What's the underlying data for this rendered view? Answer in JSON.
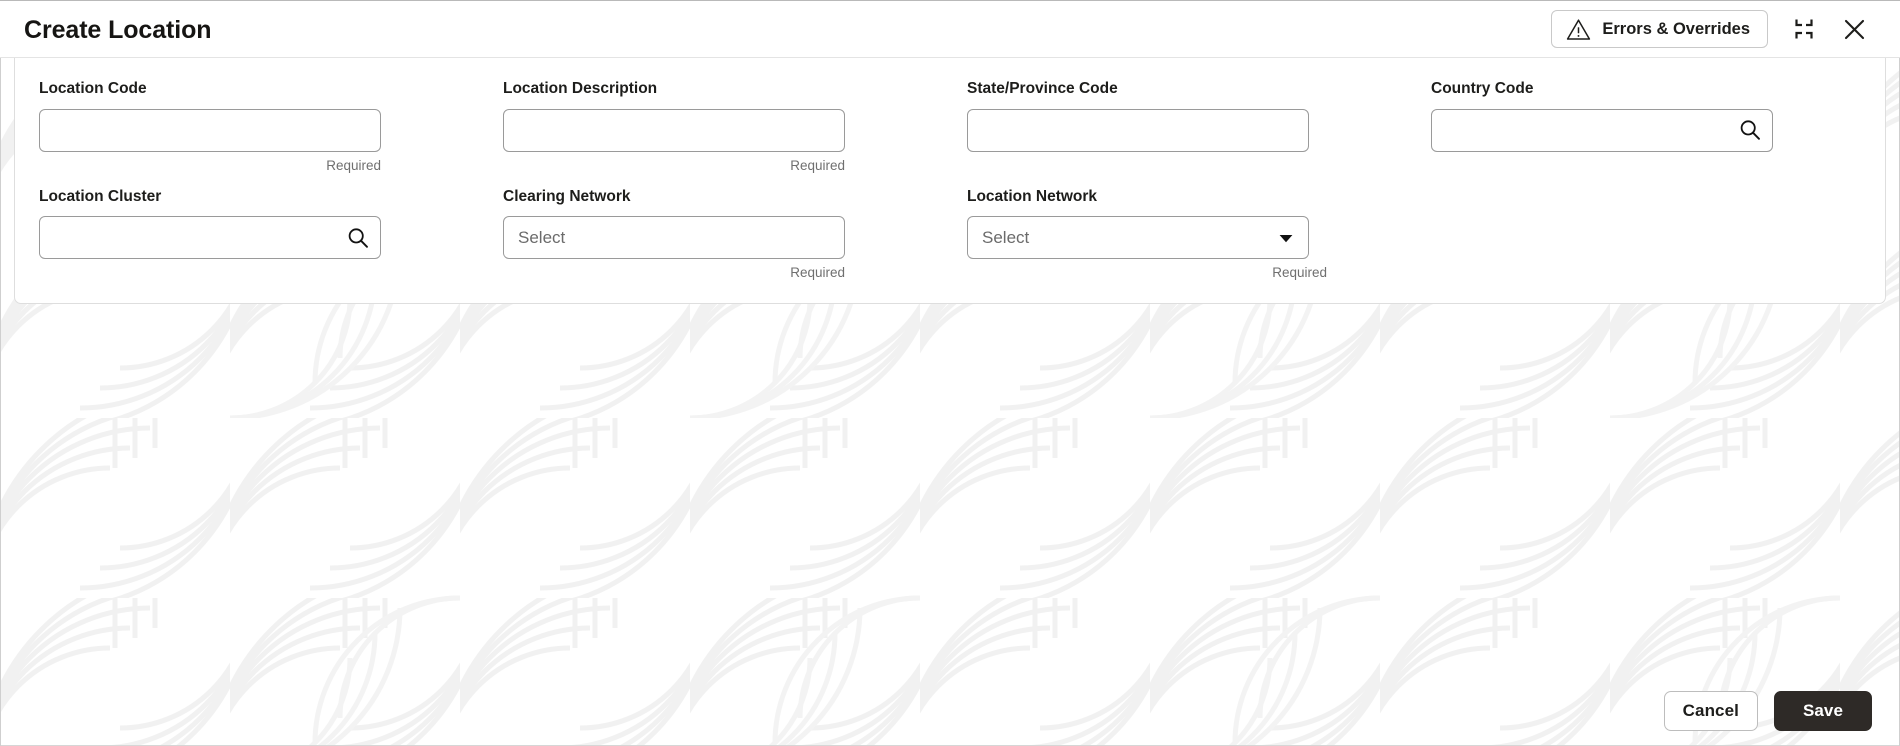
{
  "header": {
    "title": "Create Location",
    "errors_button_label": "Errors & Overrides",
    "warning_icon": "warning-triangle-icon",
    "minimize_icon": "minimize-icon",
    "close_icon": "close-icon"
  },
  "form": {
    "fields": [
      {
        "label": "Location Code",
        "value": "",
        "placeholder": "",
        "helper": "Required",
        "type": "text",
        "affix": "none"
      },
      {
        "label": "Location Description",
        "value": "",
        "placeholder": "",
        "helper": "Required",
        "type": "text",
        "affix": "none"
      },
      {
        "label": "State/Province Code",
        "value": "",
        "placeholder": "",
        "helper": "",
        "type": "text",
        "affix": "none"
      },
      {
        "label": "Country Code",
        "value": "",
        "placeholder": "",
        "helper": "",
        "type": "lov",
        "affix": "search-icon"
      },
      {
        "label": "Location Cluster",
        "value": "",
        "placeholder": "",
        "helper": "",
        "type": "lov",
        "affix": "search-icon"
      },
      {
        "label": "Clearing Network",
        "value": "",
        "placeholder": "Select",
        "helper": "Required",
        "type": "select",
        "affix": "none"
      },
      {
        "label": "Location Network",
        "value": "",
        "placeholder": "Select",
        "helper": "Required",
        "type": "dropdown",
        "affix": "chevron-down-icon"
      }
    ]
  },
  "footer": {
    "cancel_label": "Cancel",
    "save_label": "Save"
  },
  "colors": {
    "primary_button": "#2e2a27",
    "border": "#9a9a9a",
    "helper_text": "#6f6f6f",
    "watermark": "#f1f1f1"
  }
}
